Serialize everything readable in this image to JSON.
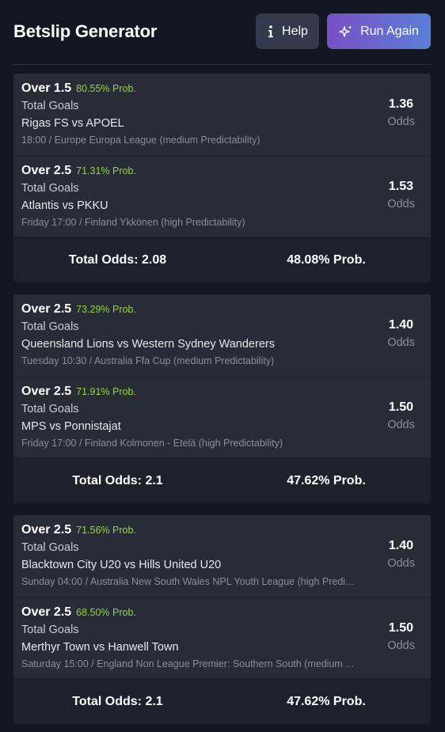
{
  "header": {
    "title": "Betslip Generator",
    "help_label": "Help",
    "run_again_label": "Run Again",
    "accent_gradient": [
      "#7a4fc6",
      "#5a7fd6"
    ]
  },
  "odds_label": "Odds",
  "prob_color": "#9ad43d",
  "slips": [
    {
      "bets": [
        {
          "market": "Over 1.5",
          "prob": "80.55% Prob.",
          "type": "Total Goals",
          "match": "Rigas FS vs APOEL",
          "meta": "18:00 / Europe Europa League (medium Predictability)",
          "odds": "1.36"
        },
        {
          "market": "Over 2.5",
          "prob": "71.31% Prob.",
          "type": "Total Goals",
          "match": "Atlantis vs PKKU",
          "meta": "Friday 17:00 / Finland Ykkönen (high Predictability)",
          "odds": "1.53"
        }
      ],
      "total_odds": "Total Odds: 2.08",
      "total_prob": "48.08% Prob."
    },
    {
      "bets": [
        {
          "market": "Over 2.5",
          "prob": "73.29% Prob.",
          "type": "Total Goals",
          "match": "Queensland Lions vs Western Sydney Wanderers",
          "meta": "Tuesday 10:30 / Australia Ffa Cup (medium Predictability)",
          "odds": "1.40"
        },
        {
          "market": "Over 2.5",
          "prob": "71.91% Prob.",
          "type": "Total Goals",
          "match": "MPS vs Ponnistajat",
          "meta": "Friday 17:00 / Finland Kolmonen - Etelä (high Predictability)",
          "odds": "1.50"
        }
      ],
      "total_odds": "Total Odds: 2.1",
      "total_prob": "47.62% Prob."
    },
    {
      "bets": [
        {
          "market": "Over 2.5",
          "prob": "71.56% Prob.",
          "type": "Total Goals",
          "match": "Blacktown City U20 vs Hills United U20",
          "meta": "Sunday 04:00 / Australia New South Wales NPL Youth League (high Predi...",
          "odds": "1.40"
        },
        {
          "market": "Over 2.5",
          "prob": "68.50% Prob.",
          "type": "Total Goals",
          "match": "Merthyr Town vs Hanwell Town",
          "meta": "Saturday 15:00 / England Non League Premier: Southern South (medium ...",
          "odds": "1.50"
        }
      ],
      "total_odds": "Total Odds: 2.1",
      "total_prob": "47.62% Prob."
    }
  ]
}
